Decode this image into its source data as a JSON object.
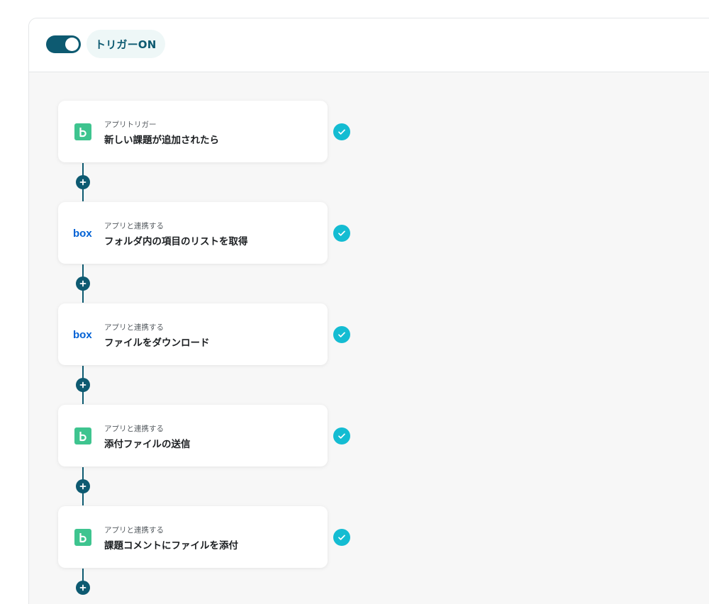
{
  "header": {
    "trigger_label": "トリガーON",
    "trigger_on": true
  },
  "colors": {
    "accent": "#0d5a71",
    "check": "#14bcd2",
    "backlog_green": "#3ec48f",
    "box_blue": "#0061d5"
  },
  "steps": [
    {
      "sub": "アプリトリガー",
      "title": "新しい課題が追加されたら",
      "icon": "backlog-icon"
    },
    {
      "sub": "アプリと連携する",
      "title": "フォルダ内の項目のリストを取得",
      "icon": "box-logo-icon"
    },
    {
      "sub": "アプリと連携する",
      "title": "ファイルをダウンロード",
      "icon": "box-logo-icon"
    },
    {
      "sub": "アプリと連携する",
      "title": "添付ファイルの送信",
      "icon": "backlog-icon"
    },
    {
      "sub": "アプリと連携する",
      "title": "課題コメントにファイルを添付",
      "icon": "backlog-icon"
    }
  ]
}
